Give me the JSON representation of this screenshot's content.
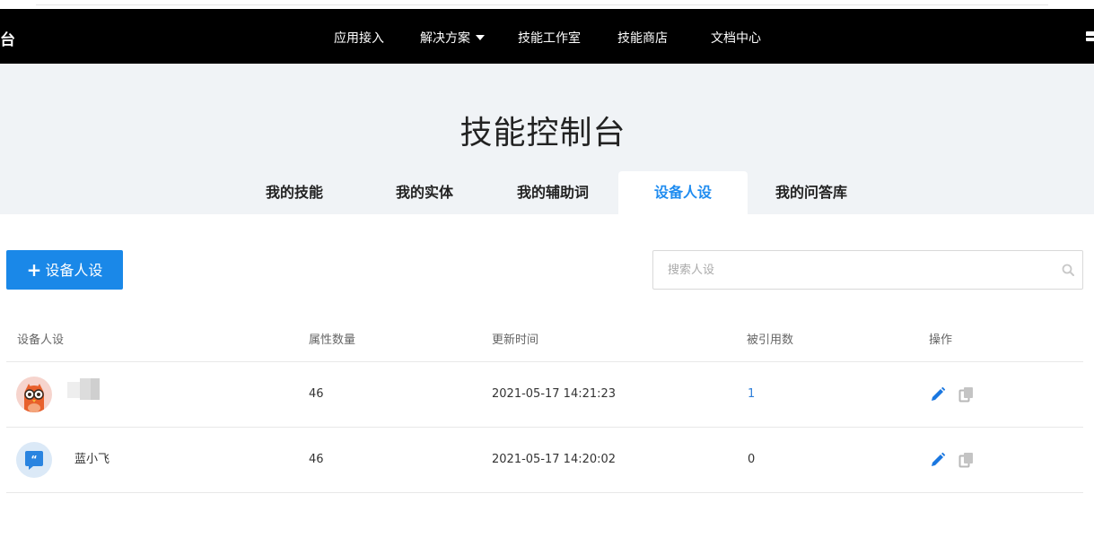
{
  "nav": {
    "brand": "台",
    "items": [
      {
        "label": "应用接入"
      },
      {
        "label": "解决方案"
      },
      {
        "label": "技能工作室"
      },
      {
        "label": "技能商店"
      },
      {
        "label": "文档中心"
      }
    ]
  },
  "page": {
    "title": "技能控制台",
    "tabs": [
      {
        "label": "我的技能"
      },
      {
        "label": "我的实体"
      },
      {
        "label": "我的辅助词"
      },
      {
        "label": "设备人设",
        "active": true
      },
      {
        "label": "我的问答库"
      }
    ]
  },
  "toolbar": {
    "add_label": "设备人设",
    "search_placeholder": "搜索人设"
  },
  "table": {
    "headers": [
      "设备人设",
      "属性数量",
      "更新时间",
      "被引用数",
      "操作"
    ],
    "rows": [
      {
        "name": "",
        "avatar": "owl-avatar",
        "attr_count": "46",
        "updated": "2021-05-17 14:21:23",
        "ref_count": "1"
      },
      {
        "name": "蓝小飞",
        "avatar": "quote-avatar",
        "attr_count": "46",
        "updated": "2021-05-17 14:20:02",
        "ref_count": "0"
      }
    ]
  },
  "colors": {
    "primary": "#1a88e8",
    "nav_bg": "#000000",
    "hero_bg": "#f0f3f6",
    "active_tab": "#1f8cf0",
    "link": "#2f7fd9"
  },
  "icons": {
    "search": "search-icon",
    "edit": "pencil-icon",
    "copy": "copy-icon",
    "mail": "mail-icon"
  }
}
